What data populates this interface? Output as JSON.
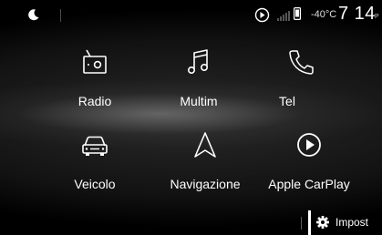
{
  "status_bar": {
    "mode_icon": "moon-icon",
    "carplay_icon": "carplay-status-icon",
    "signal_icon": "signal-icon",
    "phone_icon": "phone-status-icon",
    "temperature": "-40°C",
    "time": "7 14",
    "ampm": "P"
  },
  "tiles": [
    {
      "label": "Radio",
      "icon": "radio-icon"
    },
    {
      "label": "Multim",
      "icon": "music-note-icon"
    },
    {
      "label": "Tel",
      "icon": "phone-icon"
    },
    {
      "label": "Veicolo",
      "icon": "car-icon"
    },
    {
      "label": "Navigazione",
      "icon": "navigation-arrow-icon"
    },
    {
      "label": "Apple CarPlay",
      "icon": "carplay-icon"
    }
  ],
  "bottom_bar": {
    "settings_label": "Impost",
    "settings_icon": "gear-icon"
  }
}
